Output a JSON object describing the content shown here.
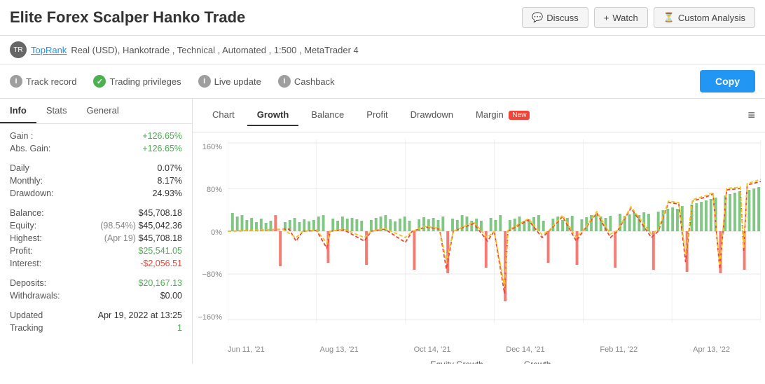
{
  "header": {
    "title": "Elite Forex Scalper Hanko Trade",
    "discuss_label": "Discuss",
    "watch_label": "Watch",
    "custom_label": "Custom Analysis"
  },
  "subheader": {
    "logo_text": "TR",
    "link_text": "TopRank",
    "details": "Real (USD), Hankotrade , Technical , Automated , 1:500 , MetaTrader 4"
  },
  "badges": [
    {
      "id": "track-record",
      "icon_type": "gray",
      "icon_text": "!",
      "label": "Track record"
    },
    {
      "id": "trading-privileges",
      "icon_type": "green",
      "icon_text": "✓",
      "label": "Trading privileges"
    },
    {
      "id": "live-update",
      "icon_type": "gray",
      "icon_text": "!",
      "label": "Live update"
    },
    {
      "id": "cashback",
      "icon_type": "gray",
      "icon_text": "!",
      "label": "Cashback"
    }
  ],
  "copy_label": "Copy",
  "left_tabs": [
    {
      "id": "info",
      "label": "Info",
      "active": true
    },
    {
      "id": "stats",
      "label": "Stats",
      "active": false
    },
    {
      "id": "general",
      "label": "General",
      "active": false
    }
  ],
  "info": {
    "gain_label": "Gain :",
    "gain_value": "+126.65%",
    "abs_gain_label": "Abs. Gain:",
    "abs_gain_value": "+126.65%",
    "daily_label": "Daily",
    "daily_value": "0.07%",
    "monthly_label": "Monthly:",
    "monthly_value": "8.17%",
    "drawdown_label": "Drawdown:",
    "drawdown_value": "24.93%",
    "balance_label": "Balance:",
    "balance_value": "$45,708.18",
    "equity_label": "Equity:",
    "equity_pct": "(98.54%)",
    "equity_value": "$45,042.36",
    "highest_label": "Highest:",
    "highest_date": "(Apr 19)",
    "highest_value": "$45,708.18",
    "profit_label": "Profit:",
    "profit_value": "$25,541.05",
    "interest_label": "Interest:",
    "interest_value": "-$2,056.51",
    "deposits_label": "Deposits:",
    "deposits_value": "$20,167.13",
    "withdrawals_label": "Withdrawals:",
    "withdrawals_value": "$0.00",
    "updated_label": "Updated",
    "updated_value": "Apr 19, 2022 at 13:25",
    "tracking_label": "Tracking",
    "tracking_value": "1"
  },
  "chart_tabs": [
    {
      "id": "chart",
      "label": "Chart",
      "active": false
    },
    {
      "id": "growth",
      "label": "Growth",
      "active": true
    },
    {
      "id": "balance",
      "label": "Balance",
      "active": false
    },
    {
      "id": "profit",
      "label": "Profit",
      "active": false
    },
    {
      "id": "drawdown",
      "label": "Drawdown",
      "active": false
    },
    {
      "id": "margin",
      "label": "Margin",
      "active": false,
      "badge": "New"
    }
  ],
  "chart": {
    "y_labels": [
      "160%",
      "80%",
      "0%",
      "-80%",
      "-160%"
    ],
    "x_labels": [
      "Jun 11, '21",
      "Aug 13, '21",
      "Oct 14, '21",
      "Dec 14, '21",
      "Feb 11, '22",
      "Apr 13, '22"
    ],
    "legend": [
      {
        "id": "equity-growth",
        "label": "Equity Growth",
        "color": "#f5c518",
        "style": "dashed"
      },
      {
        "id": "growth",
        "label": "Growth",
        "color": "#f44336",
        "style": "dashed"
      }
    ]
  },
  "colors": {
    "accent_blue": "#2196F3",
    "green": "#4caf50",
    "red": "#f44336",
    "yellow": "#f5c518"
  }
}
